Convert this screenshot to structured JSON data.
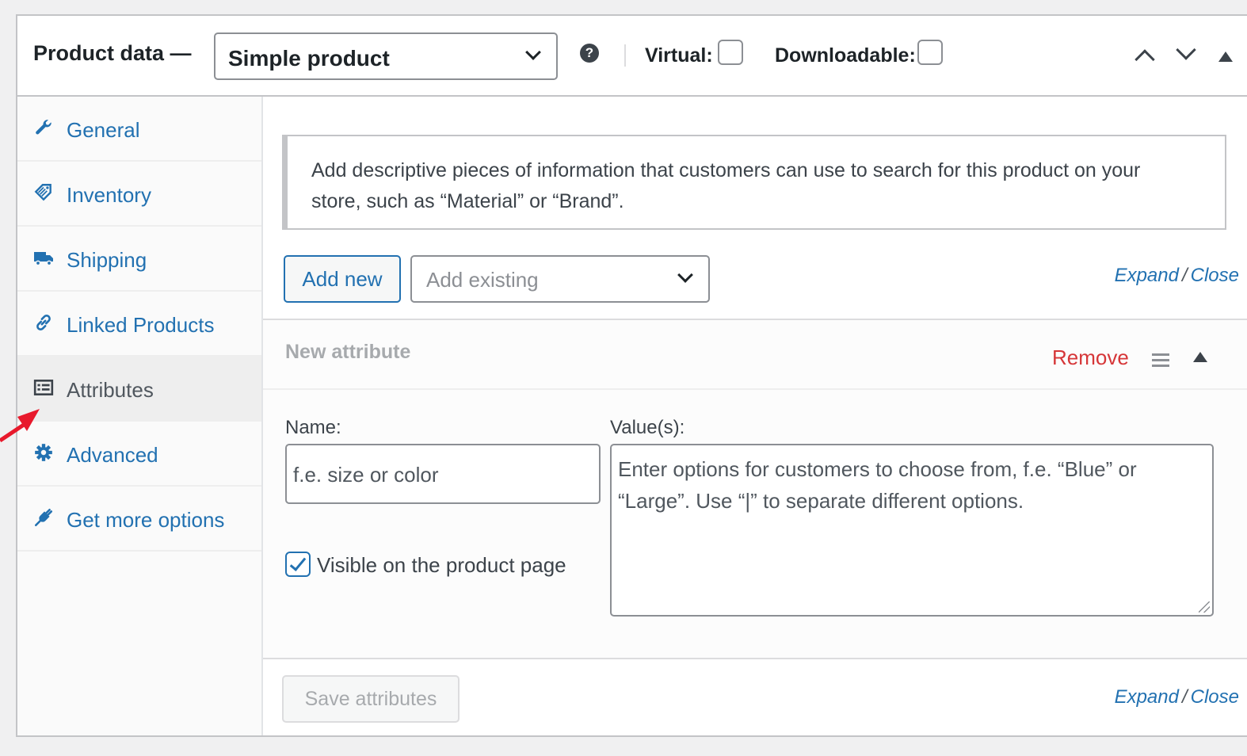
{
  "header": {
    "title": "Product data —",
    "product_type": "Simple product",
    "help_icon": "question-circle-icon",
    "virtual_label": "Virtual:",
    "virtual_checked": false,
    "downloadable_label": "Downloadable:",
    "downloadable_checked": false
  },
  "sidebar": {
    "items": [
      {
        "label": "General",
        "icon": "wrench-icon"
      },
      {
        "label": "Inventory",
        "icon": "tag-icon"
      },
      {
        "label": "Shipping",
        "icon": "truck-icon"
      },
      {
        "label": "Linked Products",
        "icon": "link-icon"
      },
      {
        "label": "Attributes",
        "icon": "list-view-icon",
        "active": true
      },
      {
        "label": "Advanced",
        "icon": "gear-icon"
      },
      {
        "label": "Get more options",
        "icon": "plugin-icon"
      }
    ]
  },
  "main": {
    "notice": "Add descriptive pieces of information that customers can use to search for this product on your store, such as “Material” or “Brand”.",
    "add_new_label": "Add new",
    "add_existing_placeholder": "Add existing",
    "expand_label": "Expand",
    "separator": "/",
    "close_label": "Close",
    "attribute": {
      "title": "New attribute",
      "remove_label": "Remove",
      "name_label": "Name:",
      "name_placeholder": "f.e. size or color",
      "values_label": "Value(s):",
      "values_placeholder": "Enter options for customers to choose from, f.e. “Blue” or “Large”. Use “|” to separate different options.",
      "visible_label": "Visible on the product page",
      "visible_checked": true
    },
    "save_label": "Save attributes"
  },
  "colors": {
    "link": "#2271b1",
    "remove": "#d63638",
    "annotation_arrow": "#e8192c"
  }
}
